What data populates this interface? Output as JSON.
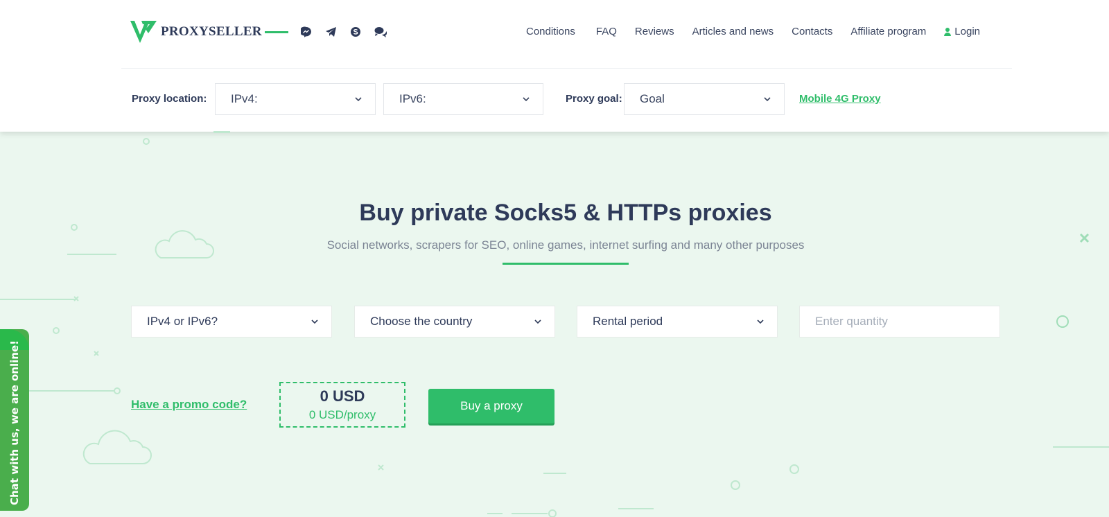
{
  "header": {
    "brand": "PROXYSELLER",
    "social_icons": [
      "messenger-icon",
      "telegram-icon",
      "skype-icon",
      "chat-bubbles-icon"
    ],
    "nav": [
      "Conditions",
      "FAQ",
      "Reviews",
      "Articles and news",
      "Contacts",
      "Affiliate program"
    ],
    "login": "Login"
  },
  "filters": {
    "location_label": "Proxy location:",
    "ipv4": "IPv4:",
    "ipv6": "IPv6:",
    "goal_label": "Proxy goal:",
    "goal": "Goal",
    "mobile_link": "Mobile 4G Proxy"
  },
  "hero": {
    "title": "Buy private Socks5 & HTTPs proxies",
    "subtitle": "Social networks, scrapers for SEO, online games, internet surfing and many other purposes"
  },
  "form": {
    "protocol": "IPv4 or IPv6?",
    "country": "Choose the country",
    "period": "Rental period",
    "quantity_placeholder": "Enter quantity"
  },
  "order": {
    "promo": "Have a promo code?",
    "total": "0 USD",
    "per_proxy": "0 USD/proxy",
    "buy": "Buy a proxy"
  },
  "chat": {
    "label": "Chat with us, we are online!"
  },
  "colors": {
    "accent": "#2fbd6a",
    "text": "#2e3a59",
    "background": "#ebf7ef",
    "chat": "#4aae4c"
  }
}
